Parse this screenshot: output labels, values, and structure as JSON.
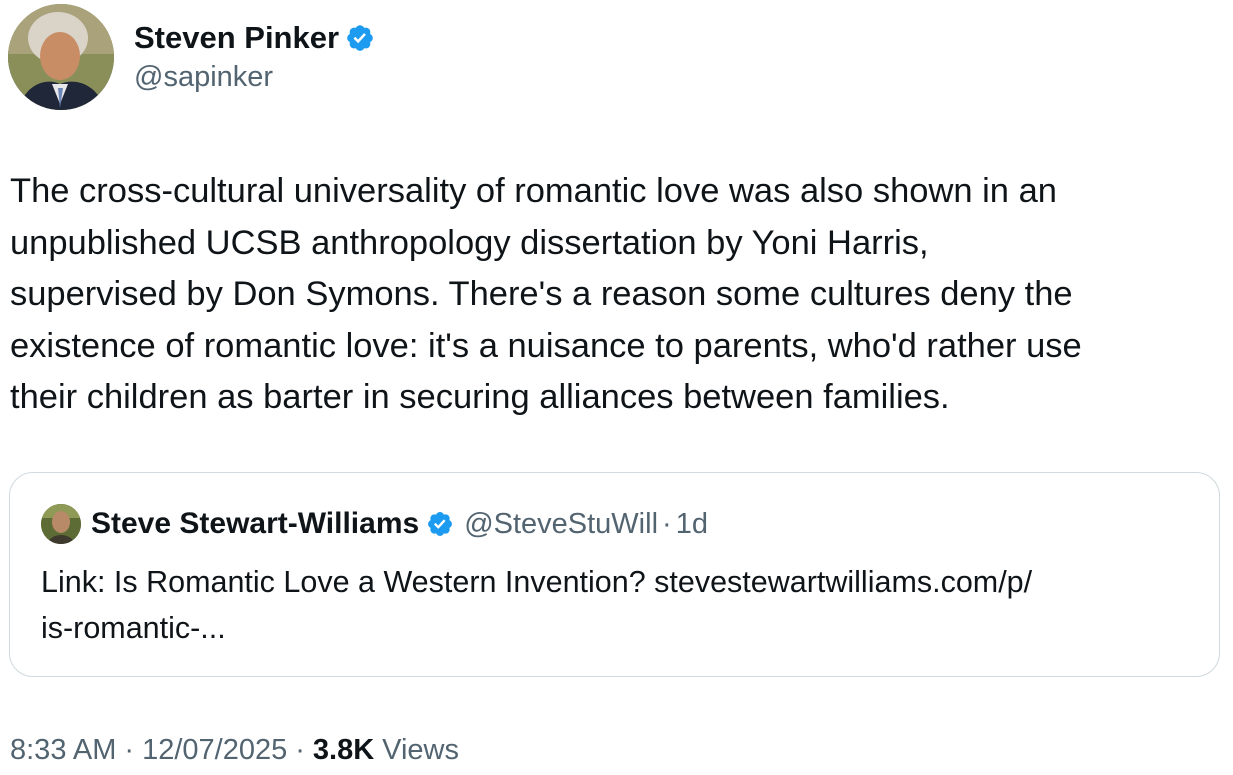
{
  "author": {
    "name": "Steven Pinker",
    "handle": "@sapinker",
    "verified_icon": "verified-badge-icon"
  },
  "tweet": {
    "text": "The cross-cultural universality of romantic love was also shown in an\nunpublished UCSB anthropology dissertation by Yoni Harris,\nsupervised by Don Symons. There's a reason some cultures deny the\nexistence of romantic love: it's a nuisance to parents, who'd rather use\ntheir children as barter in securing alliances between families."
  },
  "quote": {
    "name": "Steve Stewart-Williams",
    "handle": "@SteveStuWill",
    "separator": "·",
    "time": "1d",
    "text": "Link: Is Romantic Love a Western Invention? stevestewartwilliams.com/p/\nis-romantic-..."
  },
  "meta": {
    "time": "8:33 AM",
    "separator": "·",
    "date": "12/07/2025",
    "views_count": "3.8K",
    "views_label": "Views"
  },
  "colors": {
    "text_primary": "#0f1419",
    "text_secondary": "#536471",
    "verified_blue": "#1d9bf0",
    "border": "#cfd9de"
  }
}
